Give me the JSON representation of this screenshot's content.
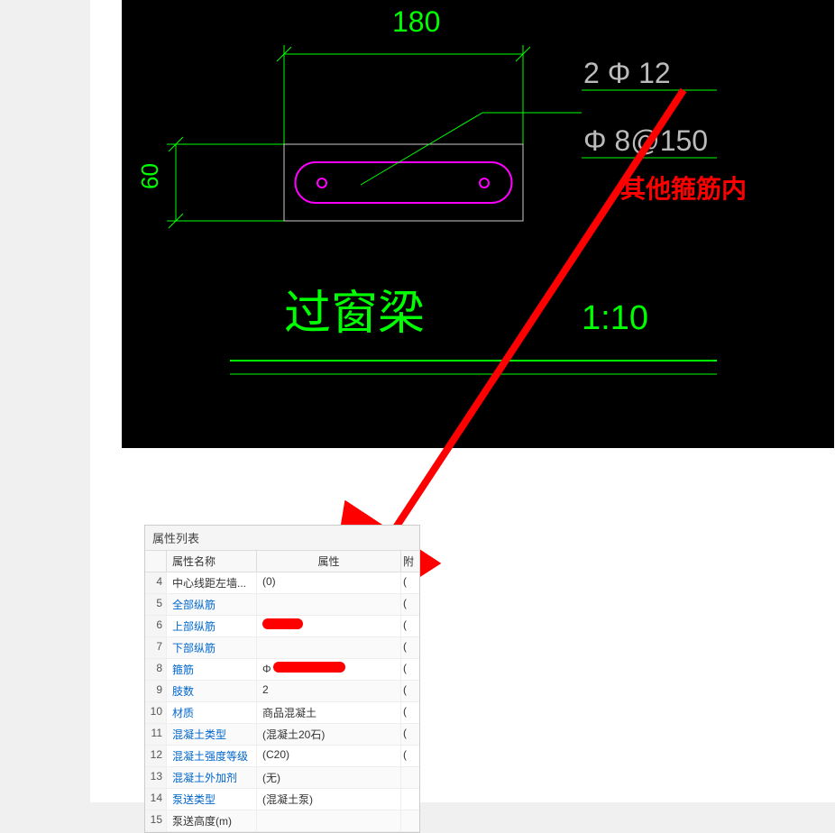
{
  "cad": {
    "dim_width": "180",
    "dim_height": "60",
    "label_main": "2 Φ 12",
    "label_stirrup": "Φ 8@150",
    "title": "过窗梁",
    "scale": "1:10"
  },
  "annotation": {
    "red_text": "其他箍筋内"
  },
  "table": {
    "title": "属性列表",
    "headers": {
      "name": "属性名称",
      "value": "属性",
      "extra": "附"
    },
    "rows": [
      {
        "num": "4",
        "name": "中心线距左墙...",
        "value": "(0)",
        "link": false,
        "extra": "("
      },
      {
        "num": "5",
        "name": "全部纵筋",
        "value": "",
        "link": true,
        "extra": "("
      },
      {
        "num": "6",
        "name": "上部纵筋",
        "value": "",
        "redact": "r1",
        "link": true,
        "extra": "("
      },
      {
        "num": "7",
        "name": "下部纵筋",
        "value": "",
        "link": true,
        "extra": "("
      },
      {
        "num": "8",
        "name": "箍筋",
        "value": "",
        "redact": "r2",
        "prefix": "Φ",
        "link": true,
        "extra": "("
      },
      {
        "num": "9",
        "name": "肢数",
        "value": "2",
        "link": true,
        "extra": "("
      },
      {
        "num": "10",
        "name": "材质",
        "value": "商品混凝土",
        "link": true,
        "extra": "("
      },
      {
        "num": "11",
        "name": "混凝土类型",
        "value": "(混凝土20石)",
        "link": true,
        "extra": "("
      },
      {
        "num": "12",
        "name": "混凝土强度等级",
        "value": "(C20)",
        "link": true,
        "extra": "("
      },
      {
        "num": "13",
        "name": "混凝土外加剂",
        "value": "(无)",
        "link": true,
        "extra": ""
      },
      {
        "num": "14",
        "name": "泵送类型",
        "value": "(混凝土泵)",
        "link": true,
        "extra": ""
      },
      {
        "num": "15",
        "name": "泵送高度(m)",
        "value": "",
        "link": false,
        "extra": ""
      }
    ]
  }
}
